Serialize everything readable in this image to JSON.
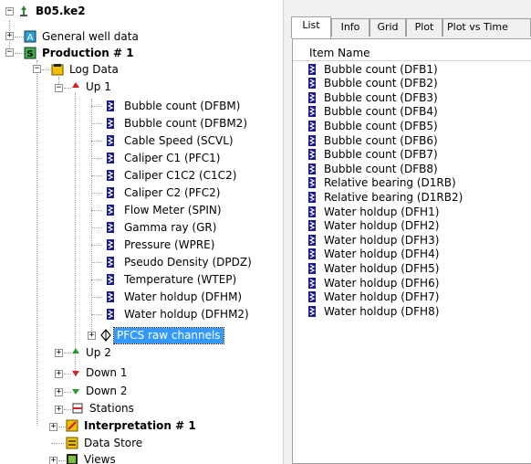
{
  "tree": {
    "root": "B05.ke2",
    "general": "General well data",
    "production": "Production # 1",
    "log_data": "Log Data",
    "up1": "Up 1",
    "channels": [
      "Bubble count (DFBM)",
      "Bubble count (DFBM2)",
      "Cable Speed (SCVL)",
      "Caliper C1 (PFC1)",
      "Caliper C1C2 (C1C2)",
      "Caliper C2 (PFC2)",
      "Flow Meter (SPIN)",
      "Gamma ray (GR)",
      "Pressure (WPRE)",
      "Pseudo Density (DPDZ)",
      "Temperature (WTEP)",
      "Water holdup (DFHM)",
      "Water holdup (DFHM2)"
    ],
    "pfcs": "PFCS raw channels",
    "up2": "Up 2",
    "down1": "Down 1",
    "down2": "Down 2",
    "stations": "Stations",
    "interpretation": "Interpretation # 1",
    "data_store": "Data Store",
    "views": "Views"
  },
  "tabs": [
    "List",
    "Info",
    "Grid",
    "Plot",
    "Plot vs Time"
  ],
  "list": {
    "column_header": "Item Name",
    "items": [
      "Bubble count (DFB1)",
      "Bubble count (DFB2)",
      "Bubble count (DFB3)",
      "Bubble count (DFB4)",
      "Bubble count (DFB5)",
      "Bubble count (DFB6)",
      "Bubble count (DFB7)",
      "Bubble count (DFB8)",
      "Relative bearing (D1RB)",
      "Relative bearing (D1RB2)",
      "Water holdup (DFH1)",
      "Water holdup (DFH2)",
      "Water holdup (DFH3)",
      "Water holdup (DFH4)",
      "Water holdup (DFH5)",
      "Water holdup (DFH6)",
      "Water holdup (DFH7)",
      "Water holdup (DFH8)"
    ]
  },
  "colors": {
    "selection": "#3399ff",
    "channel_icon": "#1a1a8c",
    "arrow_up": "#d42020",
    "arrow_down_green": "#20a030",
    "folder": "#f0c000"
  }
}
